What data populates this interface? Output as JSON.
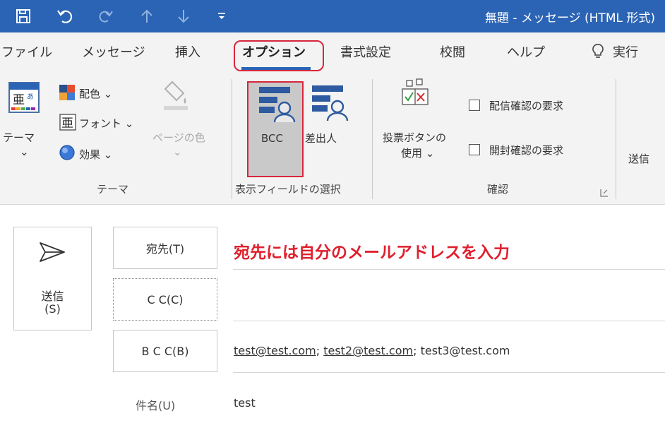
{
  "window": {
    "title": "無題 - メッセージ (HTML 形式)"
  },
  "quick_access": [
    "save-icon",
    "undo-icon",
    "redo-icon",
    "up-arrow-icon",
    "down-arrow-icon",
    "customize-qat-icon"
  ],
  "tabs": [
    {
      "label": "ファイル",
      "active": false
    },
    {
      "label": "メッセージ",
      "active": false
    },
    {
      "label": "挿入",
      "active": false
    },
    {
      "label": "オプション",
      "active": true
    },
    {
      "label": "書式設定",
      "active": false
    },
    {
      "label": "校閲",
      "active": false
    },
    {
      "label": "ヘルプ",
      "active": false
    }
  ],
  "tell_me": {
    "icon": "lightbulb-icon",
    "label": "実行"
  },
  "ribbon": {
    "theme_group": {
      "label": "テーマ",
      "theme_button": "テーマ",
      "theme_chevron": "⌄",
      "colors": "配色 ⌄",
      "fonts": "フォント ⌄",
      "effects": "効果 ⌄",
      "page_color": "ページの色",
      "page_color_chevron": "⌄"
    },
    "fields_group": {
      "label": "表示フィールドの選択",
      "bcc": "BCC",
      "from": "差出人"
    },
    "tracking_group": {
      "label": "確認",
      "voting_line1": "投票ボタンの",
      "voting_line2": "使用 ⌄",
      "delivery_receipt": "配信確認の要求",
      "read_receipt": "開封確認の要求",
      "launcher": "⌟"
    },
    "more_options_label": "送信"
  },
  "compose": {
    "send_label": "送信",
    "send_accel": "(S)",
    "to_button": "宛先(T)",
    "cc_button": "C C(C)",
    "bcc_button": "B C C(B)",
    "subject_label": "件名(U)",
    "annotation": "宛先には自分のメールアドレスを入力",
    "bcc_addresses": [
      "test@test.com",
      "test2@test.com",
      "test3@test.com"
    ],
    "subject_value": "test"
  },
  "colors": {
    "titlebar": "#2b64b4",
    "highlight": "#d7263d",
    "annotation": "#e01f2d"
  }
}
